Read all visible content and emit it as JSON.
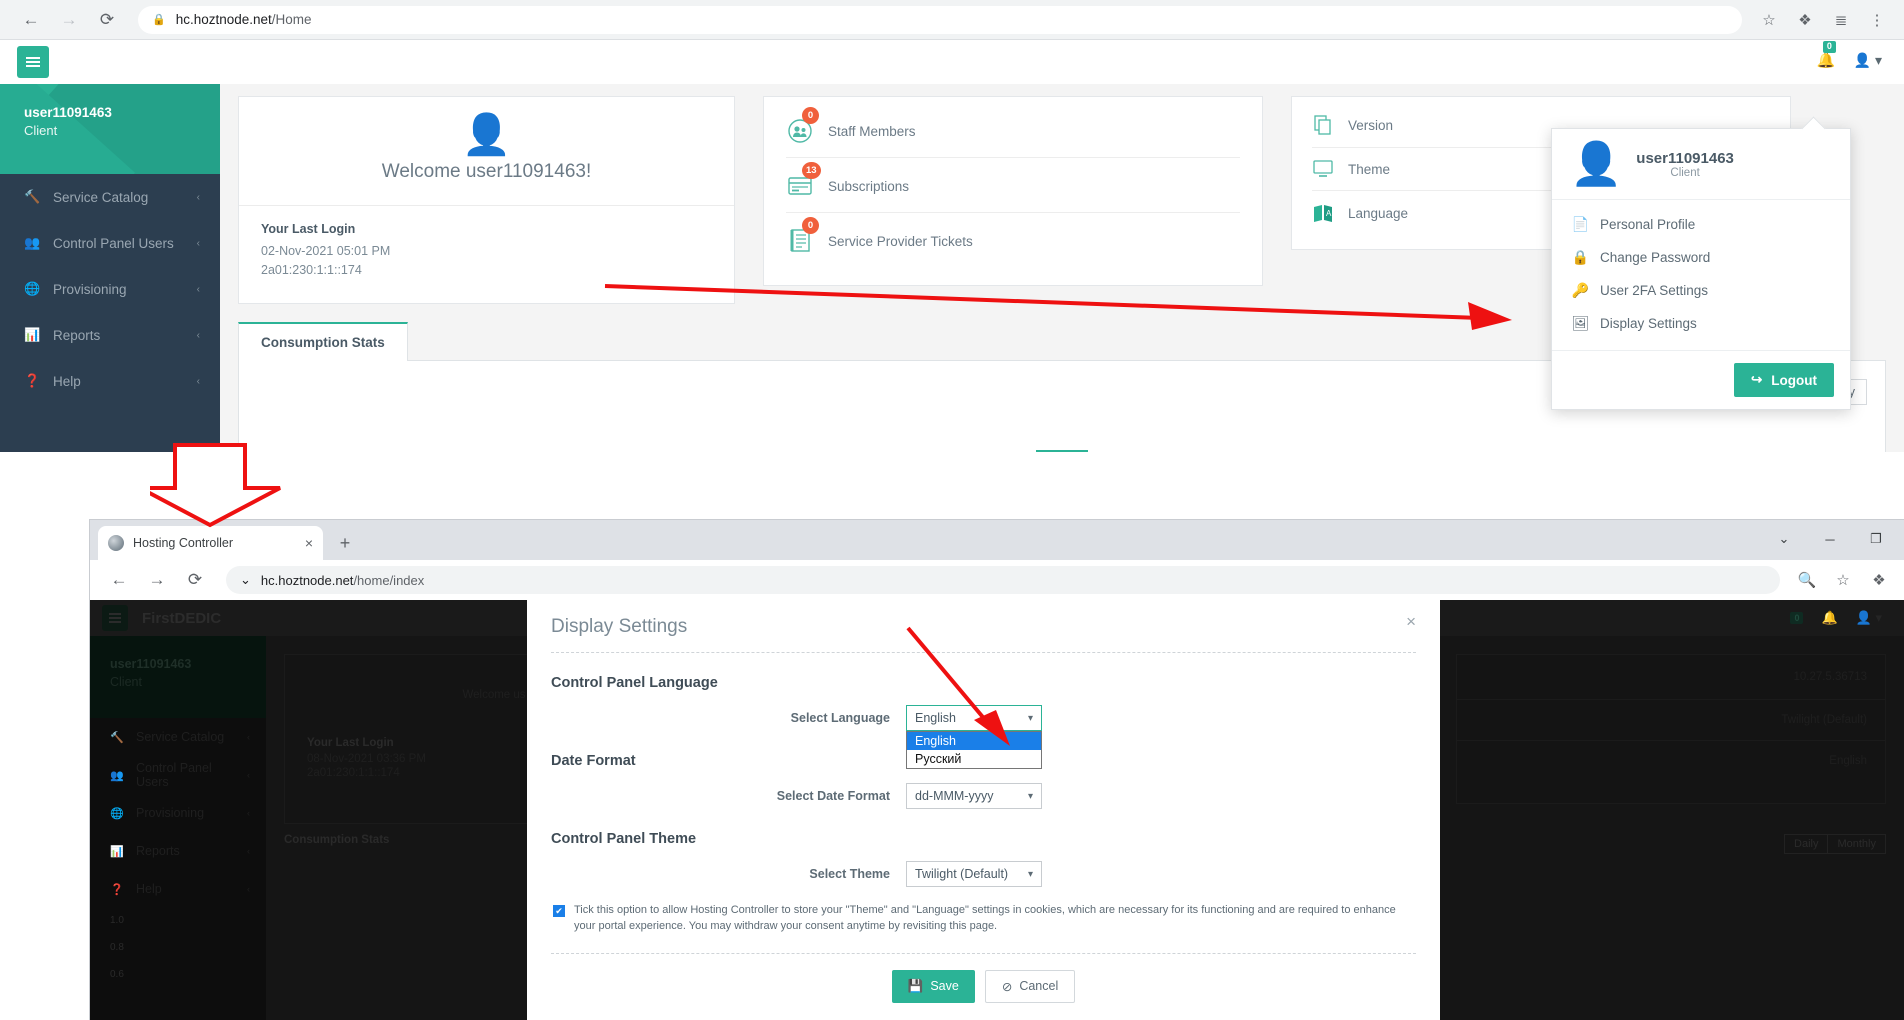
{
  "top_browser": {
    "omnibox": {
      "host": "hc.hoztnode.net",
      "path": "/Home",
      "lock_icon": "lock-icon"
    },
    "nav": {
      "back": "←",
      "forward": "→",
      "reload": "⟳"
    },
    "actions": {
      "star": "☆",
      "extensions": "❖",
      "reading_list": "≣",
      "menu": "⋮"
    }
  },
  "app": {
    "header": {
      "menu_toggle": "☰",
      "notification_count": "0",
      "user_caret": "▾"
    },
    "sidebar": {
      "user": "user11091463",
      "role": "Client",
      "items": [
        {
          "label": "Service Catalog",
          "icon": "🔨",
          "chevron": "‹"
        },
        {
          "label": "Control Panel Users",
          "icon": "👥",
          "chevron": "‹"
        },
        {
          "label": "Provisioning",
          "icon": "🌐",
          "chevron": "‹"
        },
        {
          "label": "Reports",
          "icon": "📊",
          "chevron": "‹"
        },
        {
          "label": "Help",
          "icon": "❓",
          "chevron": "‹"
        }
      ]
    },
    "welcome_card": {
      "avatar_icon": "user-avatar-icon",
      "greeting": "Welcome user11091463!",
      "last_login_title": "Your Last Login",
      "last_login_time": "02-Nov-2021 05:01 PM",
      "last_login_ip": "2a01:230:1:1::174"
    },
    "stats_card": {
      "rows": [
        {
          "label": "Staff Members",
          "count": "0",
          "icon": "staff-members-icon"
        },
        {
          "label": "Subscriptions",
          "count": "13",
          "icon": "subscriptions-icon"
        },
        {
          "label": "Service Provider Tickets",
          "count": "0",
          "icon": "tickets-icon"
        }
      ]
    },
    "info_card": {
      "rows": [
        {
          "label": "Version",
          "icon": "version-icon",
          "value": ""
        },
        {
          "label": "Theme",
          "icon": "theme-icon",
          "value": ""
        },
        {
          "label": "Language",
          "icon": "language-icon",
          "value": ""
        }
      ]
    },
    "tabs": [
      {
        "label": "Consumption Stats",
        "active": true
      }
    ],
    "panel_tools": {
      "chart_types": [
        {
          "label": "📊",
          "name": "bar-chart-icon"
        },
        {
          "label": "📈",
          "name": "line-chart-icon"
        },
        {
          "label": "◕",
          "name": "pie-chart-icon"
        }
      ],
      "periods": [
        {
          "label": "Daily",
          "active": true
        },
        {
          "label": "Monthly",
          "active": false
        }
      ]
    }
  },
  "user_menu": {
    "name": "user11091463",
    "role": "Client",
    "avatar_icon": "user-avatar-icon",
    "items": [
      {
        "label": "Personal Profile",
        "icon": "📄",
        "name": "personal-profile"
      },
      {
        "label": "Change Password",
        "icon": "🔒",
        "name": "change-password"
      },
      {
        "label": "User 2FA Settings",
        "icon": "🔑",
        "name": "user-2fa-settings"
      },
      {
        "label": "Display Settings",
        "icon": "🖼",
        "name": "display-settings"
      }
    ],
    "logout_label": "Logout",
    "logout_icon": "↪"
  },
  "bottom_browser": {
    "tab": {
      "title": "Hosting Controller",
      "close": "×"
    },
    "new_tab": "+",
    "window_buttons": {
      "minimize_list": "⌄",
      "minimize": "─",
      "maximize": "❐"
    },
    "omnibox": {
      "chevron": "⌄",
      "host": "hc.hoztnode.net",
      "path": "/home/index"
    },
    "nav": {
      "back": "←",
      "forward": "→",
      "reload": "⟳"
    },
    "actions": {
      "zoom": "🔍",
      "star": "☆",
      "extensions": "❖"
    }
  },
  "dark_app": {
    "brand": "FirstDEDIC",
    "menu_toggle": "☰",
    "notification_count": "0",
    "sidebar": {
      "user": "user11091463",
      "role": "Client",
      "items": [
        {
          "label": "Service Catalog",
          "icon": "🔨",
          "chevron": "‹"
        },
        {
          "label": "Control Panel Users",
          "icon": "👥",
          "chevron": "‹"
        },
        {
          "label": "Provisioning",
          "icon": "🌐",
          "chevron": "‹"
        },
        {
          "label": "Reports",
          "icon": "📊",
          "chevron": "‹"
        },
        {
          "label": "Help",
          "icon": "❓",
          "chevron": "‹"
        }
      ]
    },
    "welcome": {
      "greeting_prefix": "Welcome us",
      "last_login_title": "Your Last Login",
      "last_login_time": "08-Nov-2021 03:36 PM",
      "last_login_ip": "2a01:230:1:1::174"
    },
    "info_values": {
      "version": "10.27.5.36713",
      "theme": "Twilight (Default)",
      "language": "English"
    },
    "tab_label": "Consumption Stats",
    "periods": [
      {
        "label": "Daily"
      },
      {
        "label": "Monthly"
      }
    ],
    "y_axis": [
      "1.0",
      "0.8",
      "0.6"
    ]
  },
  "modal": {
    "title": "Display Settings",
    "close": "×",
    "sections": {
      "language": {
        "heading": "Control Panel Language",
        "field_label": "Select Language",
        "value": "English",
        "options": [
          {
            "label": "English",
            "selected": true
          },
          {
            "label": "Русский",
            "selected": false
          }
        ]
      },
      "date_format": {
        "heading": "Date Format",
        "field_label": "Select Date Format",
        "value": "dd-MMM-yyyy"
      },
      "theme": {
        "heading": "Control Panel Theme",
        "field_label": "Select Theme",
        "value": "Twilight (Default)"
      }
    },
    "consent": {
      "checked": true,
      "check_glyph": "✔",
      "text": "Tick this option to allow Hosting Controller to store your \"Theme\" and \"Language\" settings in cookies, which are necessary for its functioning and are required to enhance your portal experience. You may withdraw your consent anytime by revisiting this page."
    },
    "buttons": {
      "save": "Save",
      "save_icon": "💾",
      "cancel": "Cancel",
      "cancel_icon": "⊘"
    }
  },
  "annotations": {
    "accent_color": "#2bb396",
    "arrow_color": "#ee1111",
    "arrow_menu_to_display_settings": "arrow-pointing-to-display-settings",
    "arrow_down_to_second_window": "big-down-arrow",
    "arrow_to_language_dropdown": "arrow-pointing-to-language-select"
  }
}
